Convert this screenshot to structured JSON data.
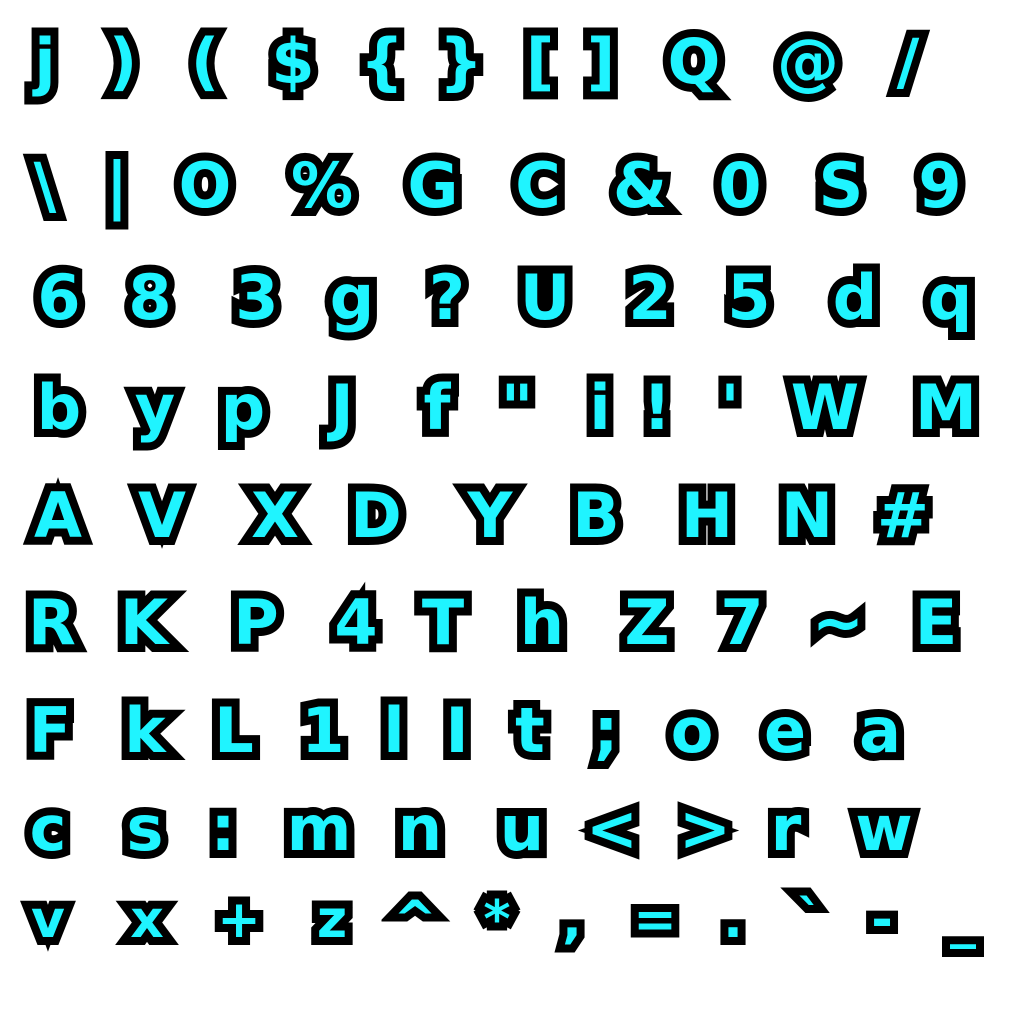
{
  "sheet": {
    "fill_color": "#1ff4ff",
    "outline_color": "#000000",
    "background_color": "#ffffff",
    "rows": [
      [
        "j",
        ")",
        "(",
        "$",
        "{",
        "}",
        "[",
        "]",
        "Q",
        "@",
        "/"
      ],
      [
        "\\",
        "|",
        "O",
        "%",
        "G",
        "C",
        "&",
        "0",
        "S",
        "9"
      ],
      [
        "6",
        "8",
        "3",
        "g",
        "?",
        "U",
        "2",
        "5",
        "d",
        "q"
      ],
      [
        "b",
        "y",
        "p",
        "J",
        "f",
        "\"",
        "i",
        "!",
        "'",
        "W",
        "M"
      ],
      [
        "A",
        "V",
        "X",
        "D",
        "Y",
        "B",
        "H",
        "N",
        "#"
      ],
      [
        "R",
        "K",
        "P",
        "4",
        "T",
        "h",
        "Z",
        "7",
        "~",
        "E"
      ],
      [
        "F",
        "k",
        "L",
        "1",
        "l",
        "I",
        "t",
        ";",
        "o",
        "e",
        "a"
      ],
      [
        "c",
        "s",
        ":",
        "m",
        "n",
        "u",
        "<",
        ">",
        "r",
        "w"
      ],
      [
        "v",
        "x",
        "+",
        "z",
        "^",
        "*",
        ",",
        "=",
        ".",
        "`",
        "-",
        "_"
      ]
    ]
  }
}
